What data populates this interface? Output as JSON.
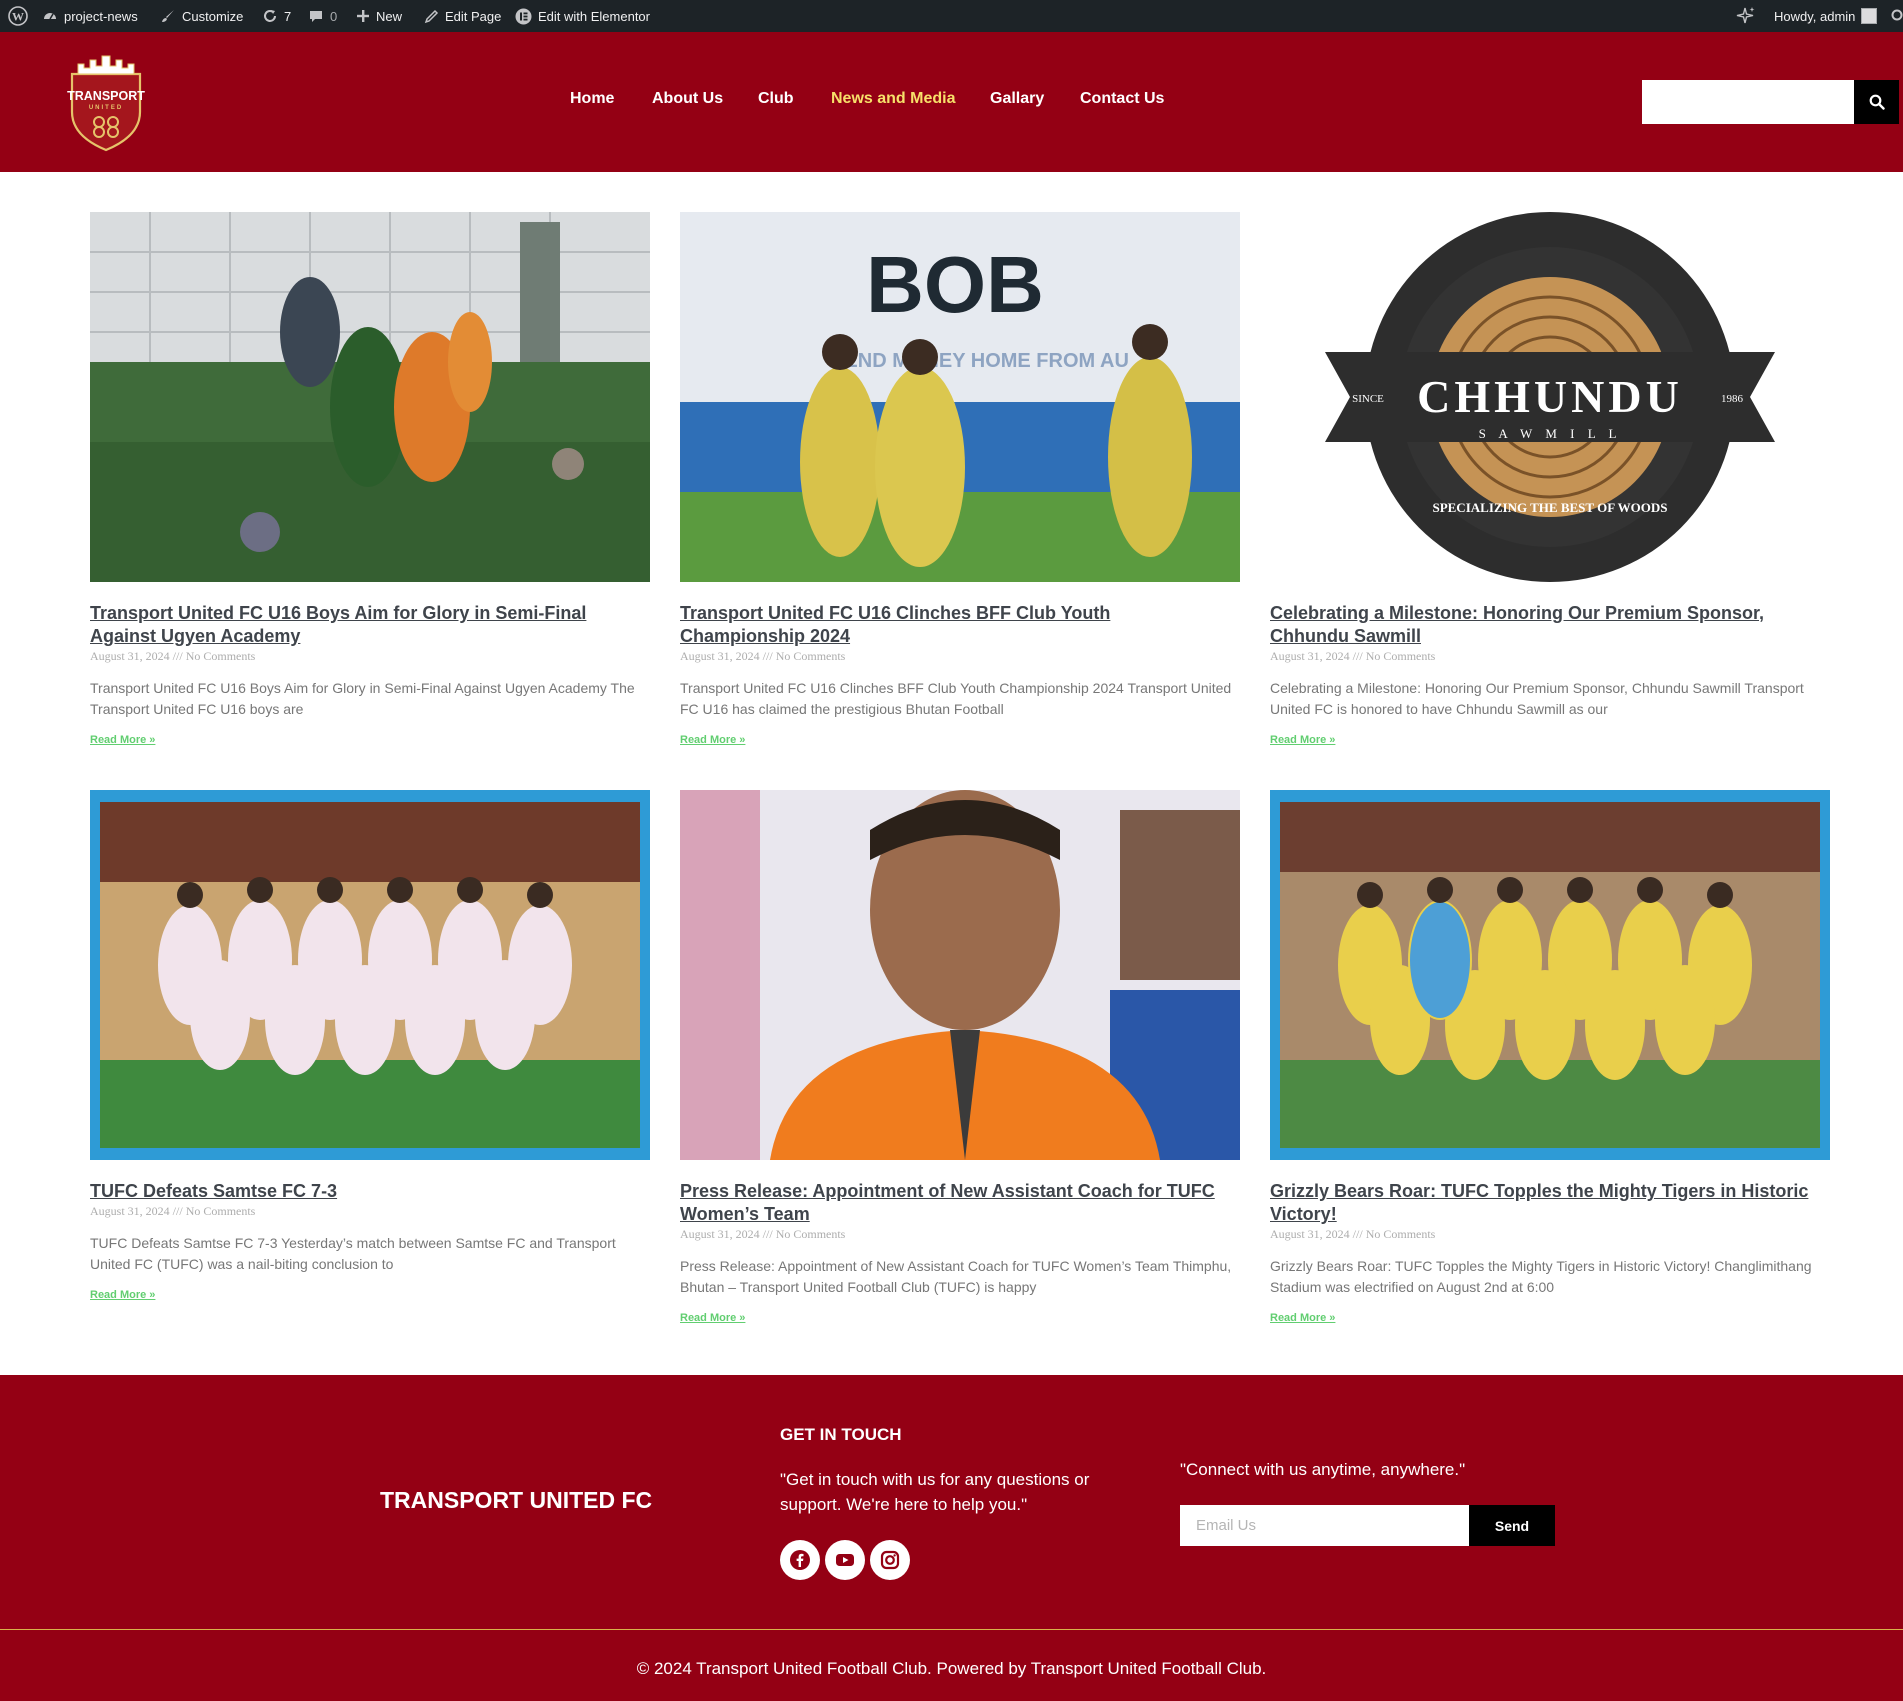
{
  "admin_bar": {
    "site_name": "project-news",
    "customize": "Customize",
    "updates_count": "7",
    "comments_count": "0",
    "new": "New",
    "edit_page": "Edit Page",
    "edit_elementor": "Edit with Elementor",
    "howdy": "Howdy, admin"
  },
  "header": {
    "logo_text_top": "TRANSPORT",
    "logo_text_bottom": "UNITED",
    "nav": [
      {
        "label": "Home"
      },
      {
        "label": "About Us"
      },
      {
        "label": "Club"
      },
      {
        "label": "News and Media",
        "active": true
      },
      {
        "label": "Gallary"
      },
      {
        "label": "Contact Us"
      }
    ],
    "search_placeholder": "",
    "active_color": "#f7e06a",
    "brand_color": "#940014"
  },
  "posts": [
    {
      "title": "Transport United FC U16 Boys Aim for Glory in Semi-Final Against Ugyen Academy",
      "date": "August 31, 2024",
      "separator": "///",
      "comments": "No Comments",
      "excerpt": "Transport United FC U16 Boys Aim for Glory in Semi-Final Against Ugyen Academy The Transport United FC U16 boys are",
      "read_more": "Read More »",
      "image": "youth-football-match-photo"
    },
    {
      "title": "Transport United FC U16 Clinches BFF Club Youth Championship 2024",
      "date": "August 31, 2024",
      "separator": "///",
      "comments": "No Comments",
      "excerpt": "Transport United FC U16 Clinches BFF Club Youth Championship 2024 Transport United FC U16 has claimed the prestigious Bhutan Football",
      "read_more": "Read More »",
      "image": "youth-team-celebration-photo",
      "banner_text": "BOB",
      "banner_sub": "SEND MONEY HOME FROM AU"
    },
    {
      "title": "Celebrating a Milestone: Honoring Our Premium Sponsor, Chhundu Sawmill",
      "date": "August 31, 2024",
      "separator": "///",
      "comments": "No Comments",
      "excerpt": "Celebrating a Milestone: Honoring Our Premium Sponsor, Chhundu Sawmill Transport United FC is honored to have Chhundu Sawmill as our",
      "read_more": "Read More »",
      "image": "chhundu-sawmill-logo",
      "logo_name": "CHHUNDU",
      "logo_sub": "S A W M I L L",
      "logo_since": "SINCE",
      "logo_year": "1986",
      "logo_tagline": "SPECIALIZING THE BEST OF WOODS"
    },
    {
      "title": "TUFC Defeats Samtse FC 7-3",
      "date": "August 31, 2024",
      "separator": "///",
      "comments": "No Comments",
      "excerpt": "TUFC Defeats Samtse FC 7-3 Yesterday’s match between Samtse FC and Transport United FC (TUFC) was a nail-biting conclusion to",
      "read_more": "Read More »",
      "image": "team-photo-white-kit"
    },
    {
      "title": "Press Release: Appointment of New Assistant Coach for TUFC Women’s Team",
      "date": "August 31, 2024",
      "separator": "///",
      "comments": "No Comments",
      "excerpt": "Press Release: Appointment of New Assistant Coach for TUFC Women’s Team Thimphu, Bhutan – Transport United Football Club (TUFC) is happy",
      "read_more": "Read More »",
      "image": "assistant-coach-portrait"
    },
    {
      "title": "Grizzly Bears Roar: TUFC Topples the Mighty Tigers in Historic Victory!",
      "date": "August 31, 2024",
      "separator": "///",
      "comments": "No Comments",
      "excerpt": "Grizzly Bears Roar: TUFC Topples the Mighty Tigers in Historic Victory! Changlimithang Stadium was electrified on August 2nd at 6:00",
      "read_more": "Read More »",
      "image": "team-photo-yellow-kit"
    }
  ],
  "footer": {
    "club_name": "TRANSPORT UNITED FC",
    "get_in_touch": "GET IN TOUCH",
    "get_in_touch_text": "\"Get in touch with us for any questions or support. We're here to help you.\"",
    "socials": [
      "facebook-icon",
      "youtube-icon",
      "instagram-icon"
    ],
    "connect_text": "\"Connect with us anytime, anywhere.\"",
    "email_placeholder": "Email Us",
    "send_label": "Send",
    "copyright": "© 2024 Transport United Football Club. Powered by Transport United Football Club."
  }
}
